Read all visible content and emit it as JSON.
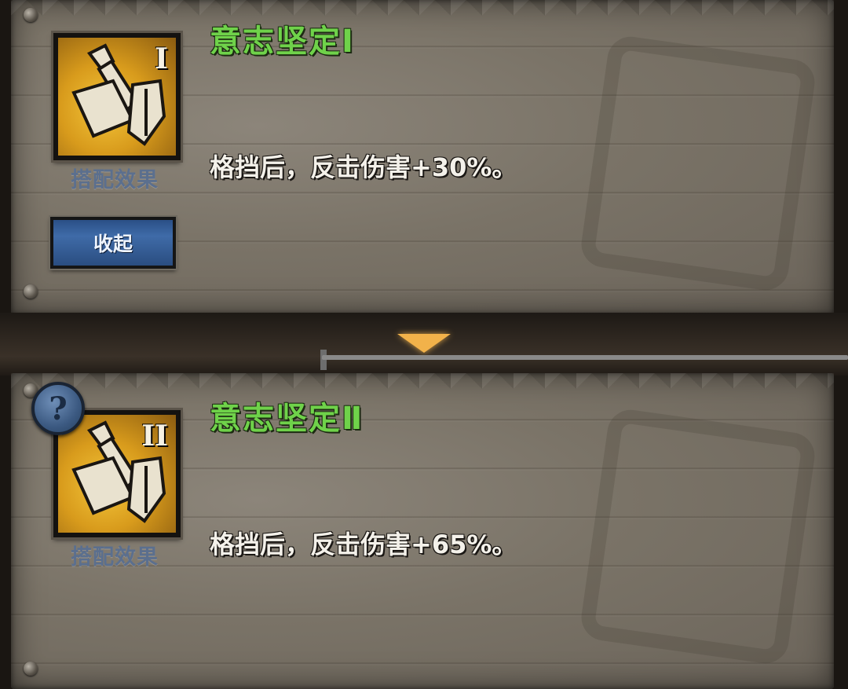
{
  "cards": [
    {
      "title": "意志坚定Ⅰ",
      "tier": "I",
      "combo_label": "搭配效果",
      "description": "格挡后，反击伤害+30%。",
      "button_label": "收起"
    },
    {
      "title": "意志坚定Ⅱ",
      "tier": "II",
      "combo_label": "搭配效果",
      "description": "格挡后，反击伤害+65%。",
      "help_label": "?"
    }
  ],
  "colors": {
    "title_green": "#6fd24a",
    "icon_gold": "#d89b1c",
    "button_blue": "#3f6ba8",
    "arrow_orange": "#f2b24a"
  },
  "icons": [
    "sword-shield-skill-icon",
    "question-icon",
    "down-arrow-icon"
  ]
}
